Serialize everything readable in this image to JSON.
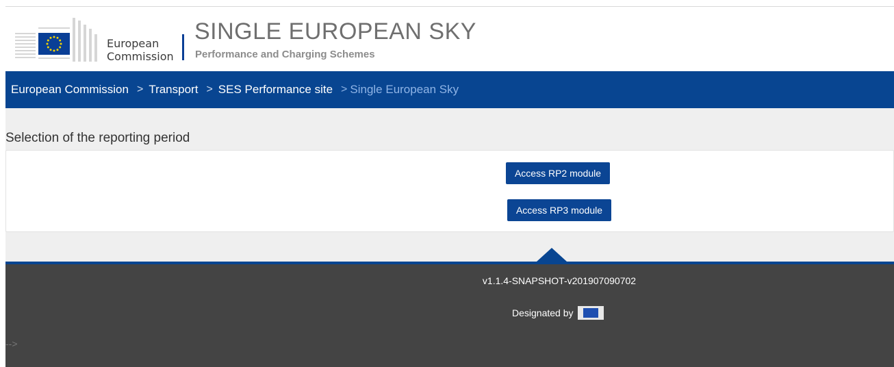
{
  "header": {
    "logo_line1": "European",
    "logo_line2": "Commission",
    "site_title": "SINGLE EUROPEAN SKY",
    "site_subtitle": "Performance and Charging Schemes"
  },
  "breadcrumb": {
    "items": [
      {
        "label": "European Commission"
      },
      {
        "label": "Transport"
      },
      {
        "label": "SES Performance site"
      },
      {
        "label": "Single European Sky"
      }
    ],
    "separator": ">"
  },
  "main": {
    "section_title": "Selection of the reporting period",
    "rp2_button": "Access RP2 module",
    "rp3_button": "Access RP3 module"
  },
  "footer": {
    "version": "v1.1.4-SNAPSHOT-v201907090702",
    "designated_by": "Designated by",
    "stray_comment": "-->"
  },
  "colors": {
    "brand_blue": "#084591",
    "footer_bg": "#444444",
    "page_bg": "#efefef"
  }
}
